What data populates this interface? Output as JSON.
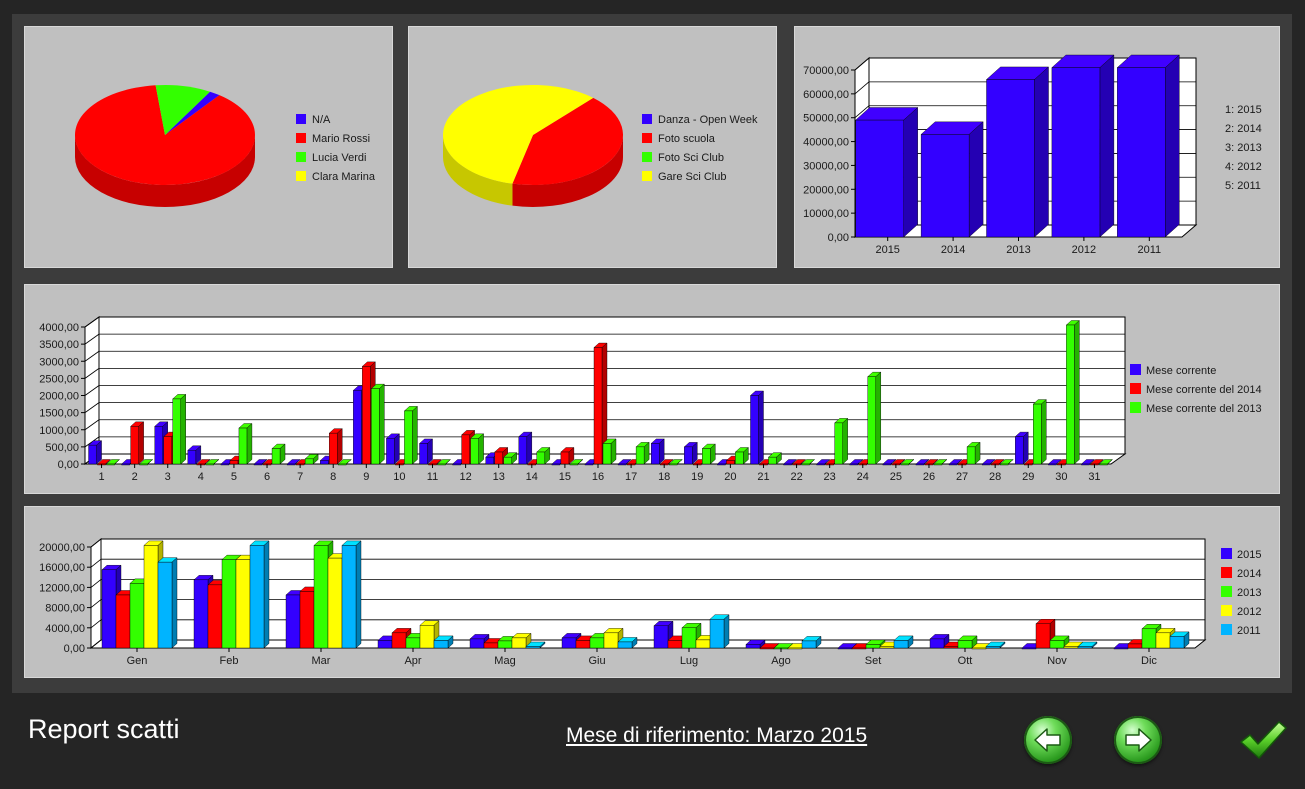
{
  "footer": {
    "title": "Report scatti",
    "reference_month": "Mese di riferimento: Marzo 2015",
    "prev_icon": "arrow-left-icon",
    "next_icon": "arrow-right-icon",
    "confirm_icon": "checkmark-icon"
  },
  "colors": {
    "blue": "#3300ff",
    "red": "#ff0000",
    "green": "#33ff00",
    "yellow": "#ffff00",
    "cyan": "#00b4ff",
    "panel": "#c0c0c0"
  },
  "chart_data": [
    {
      "type": "pie",
      "labels": [
        "N/A",
        "Mario Rossi",
        "Lucia Verdi",
        "Clara Marina"
      ],
      "values": [
        2,
        88,
        10,
        0
      ],
      "colors": [
        "#3300ff",
        "#ff0000",
        "#33ff00",
        "#ffff00"
      ],
      "legend": [
        "N/A",
        "Mario Rossi",
        "Lucia Verdi",
        "Clara Marina"
      ]
    },
    {
      "type": "pie",
      "labels": [
        "Danza - Open Week",
        "Foto scuola",
        "Foto Sci Club",
        "Gare Sci Club"
      ],
      "values": [
        0,
        42,
        0,
        58
      ],
      "colors": [
        "#3300ff",
        "#ff0000",
        "#33ff00",
        "#ffff00"
      ],
      "legend": [
        "Danza - Open Week",
        "Foto scuola",
        "Foto Sci Club",
        "Gare Sci Club"
      ]
    },
    {
      "type": "bar",
      "categories": [
        "2015",
        "2014",
        "2013",
        "2012",
        "2011"
      ],
      "values": [
        49000,
        43000,
        66000,
        71000,
        72000
      ],
      "ylim": [
        0,
        70000
      ],
      "yticks": [
        "0,00",
        "10000,00",
        "20000,00",
        "30000,00",
        "40000,00",
        "50000,00",
        "60000,00",
        "70000,00"
      ],
      "legend": [
        "1:  2015",
        "2:  2014",
        "3:  2013",
        "4:  2012",
        "5:  2011"
      ]
    },
    {
      "type": "bar",
      "categories": [
        "1",
        "2",
        "3",
        "4",
        "5",
        "6",
        "7",
        "8",
        "9",
        "10",
        "11",
        "12",
        "13",
        "14",
        "15",
        "16",
        "17",
        "18",
        "19",
        "20",
        "21",
        "22",
        "23",
        "24",
        "25",
        "26",
        "27",
        "28",
        "29",
        "30",
        "31"
      ],
      "series": [
        {
          "name": "Mese corrente",
          "color": "#3300ff",
          "values": [
            550,
            0,
            1100,
            400,
            0,
            0,
            0,
            100,
            2150,
            750,
            600,
            0,
            200,
            800,
            0,
            0,
            0,
            600,
            500,
            0,
            2000,
            0,
            0,
            0,
            0,
            0,
            0,
            0,
            800,
            0,
            0
          ]
        },
        {
          "name": "Mese corrente del 2014",
          "color": "#ff0000",
          "values": [
            0,
            1100,
            800,
            0,
            100,
            0,
            0,
            900,
            2850,
            0,
            0,
            850,
            350,
            0,
            350,
            3400,
            0,
            0,
            0,
            100,
            0,
            0,
            0,
            0,
            0,
            0,
            0,
            0,
            0,
            0,
            0
          ]
        },
        {
          "name": "Mese corrente del 2013",
          "color": "#33ff00",
          "values": [
            0,
            0,
            1900,
            0,
            1050,
            450,
            150,
            0,
            2200,
            1550,
            0,
            750,
            200,
            350,
            0,
            600,
            500,
            0,
            450,
            350,
            200,
            0,
            1200,
            2550,
            0,
            0,
            500,
            0,
            1750,
            4200,
            0
          ]
        }
      ],
      "ylim": [
        0,
        4000
      ],
      "yticks": [
        "0,00",
        "500,00",
        "1000,00",
        "1500,00",
        "2000,00",
        "2500,00",
        "3000,00",
        "3500,00",
        "4000,00"
      ]
    },
    {
      "type": "bar",
      "categories": [
        "Gen",
        "Feb",
        "Mar",
        "Apr",
        "Mag",
        "Giu",
        "Lug",
        "Ago",
        "Set",
        "Ott",
        "Nov",
        "Dic"
      ],
      "series": [
        {
          "name": "2015",
          "color": "#3300ff",
          "values": [
            15500,
            13500,
            10500,
            1500,
            1800,
            2000,
            4400,
            700,
            0,
            1800,
            0,
            0
          ]
        },
        {
          "name": "2014",
          "color": "#ff0000",
          "values": [
            10500,
            12500,
            11200,
            3000,
            1000,
            1500,
            1500,
            0,
            0,
            300,
            4800,
            800
          ]
        },
        {
          "name": "2013",
          "color": "#33ff00",
          "values": [
            12800,
            17500,
            21000,
            2000,
            1400,
            2000,
            4000,
            0,
            700,
            1500,
            1500,
            3800
          ]
        },
        {
          "name": "2012",
          "color": "#ffff00",
          "values": [
            22000,
            17500,
            17800,
            4500,
            2000,
            3000,
            1600,
            0,
            300,
            0,
            300,
            3000
          ]
        },
        {
          "name": "2011",
          "color": "#00b4ff",
          "values": [
            17000,
            23500,
            21000,
            1500,
            300,
            1200,
            5700,
            1400,
            1500,
            300,
            300,
            2300
          ]
        }
      ],
      "ylim": [
        0,
        20000
      ],
      "yticks": [
        "0,00",
        "4000,00",
        "8000,00",
        "12000,00",
        "16000,00",
        "20000,00"
      ]
    }
  ]
}
